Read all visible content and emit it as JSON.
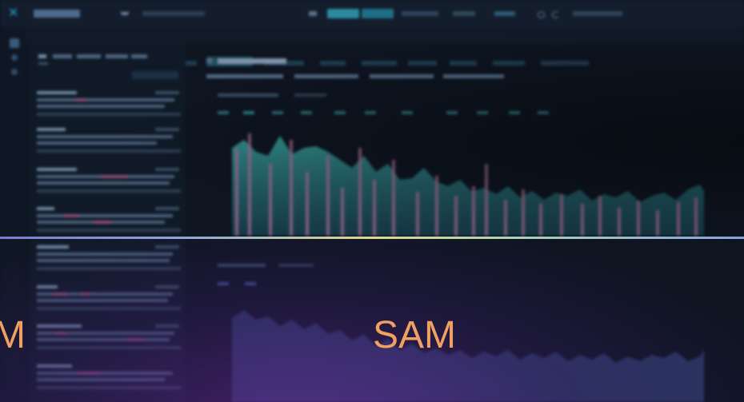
{
  "overlay": {
    "sam_left": "M",
    "sam_center": "SAM"
  },
  "colors": {
    "teal": "#2c8f8f",
    "pink": "#a56a8f",
    "purple": "#5b3a86",
    "overlay_text": "#f0a060"
  },
  "icons": {
    "logo": "x-logo-icon",
    "search": "search-icon",
    "refresh": "refresh-icon",
    "chevron": "chevron-down-icon"
  }
}
